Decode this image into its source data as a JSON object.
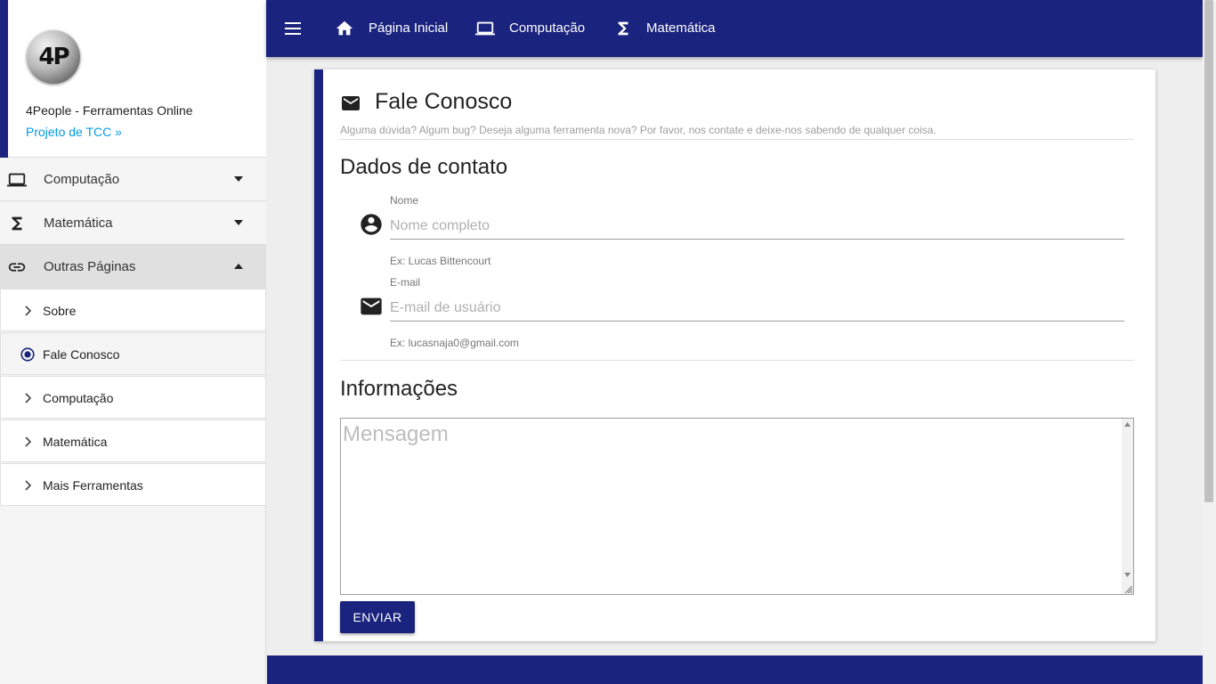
{
  "brand": {
    "logo_text": "4P",
    "title": "4People - Ferramentas Online",
    "link": "Projeto de TCC »"
  },
  "sidebar": {
    "items": [
      {
        "label": "Computação",
        "icon": "laptop-icon"
      },
      {
        "label": "Matemática",
        "icon": "sigma-icon"
      },
      {
        "label": "Outras Páginas",
        "icon": "link-icon",
        "expanded": true
      }
    ],
    "subitems": [
      {
        "label": "Sobre"
      },
      {
        "label": "Fale Conosco",
        "current": true
      },
      {
        "label": "Computação"
      },
      {
        "label": "Matemática"
      },
      {
        "label": "Mais Ferramentas"
      }
    ]
  },
  "topbar": {
    "home": "Página Inicial",
    "computacao": "Computação",
    "matematica": "Matemática"
  },
  "card": {
    "title": "Fale Conosco",
    "subtitle": "Alguma dúvida? Algum bug? Deseja alguma ferramenta nova? Por favor, nos contate e deixe-nos sabendo de qualquer coisa.",
    "section_contact": "Dados de contato",
    "name": {
      "label": "Nome",
      "placeholder": "Nome completo",
      "help": "Ex: Lucas Bittencourt"
    },
    "email": {
      "label": "E-mail",
      "placeholder": "E-mail de usuário",
      "help": "Ex: lucasnaja0@gmail.com"
    },
    "section_info": "Informações",
    "message_placeholder": "Mensagem",
    "send_label": "ENVIAR"
  },
  "colors": {
    "primary": "#1a237e",
    "link": "#039be5"
  }
}
